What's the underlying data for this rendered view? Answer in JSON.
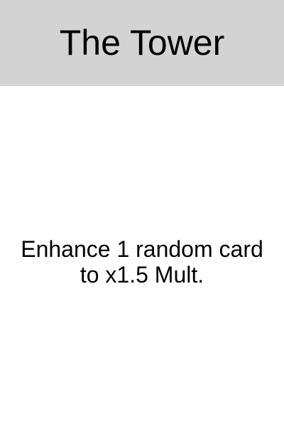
{
  "card": {
    "title": "The Tower",
    "description": "Enhance 1 random card to x1.5 Mult."
  },
  "colors": {
    "header_background": "#d3d3d3",
    "body_background": "#ffffff",
    "text": "#000000"
  }
}
